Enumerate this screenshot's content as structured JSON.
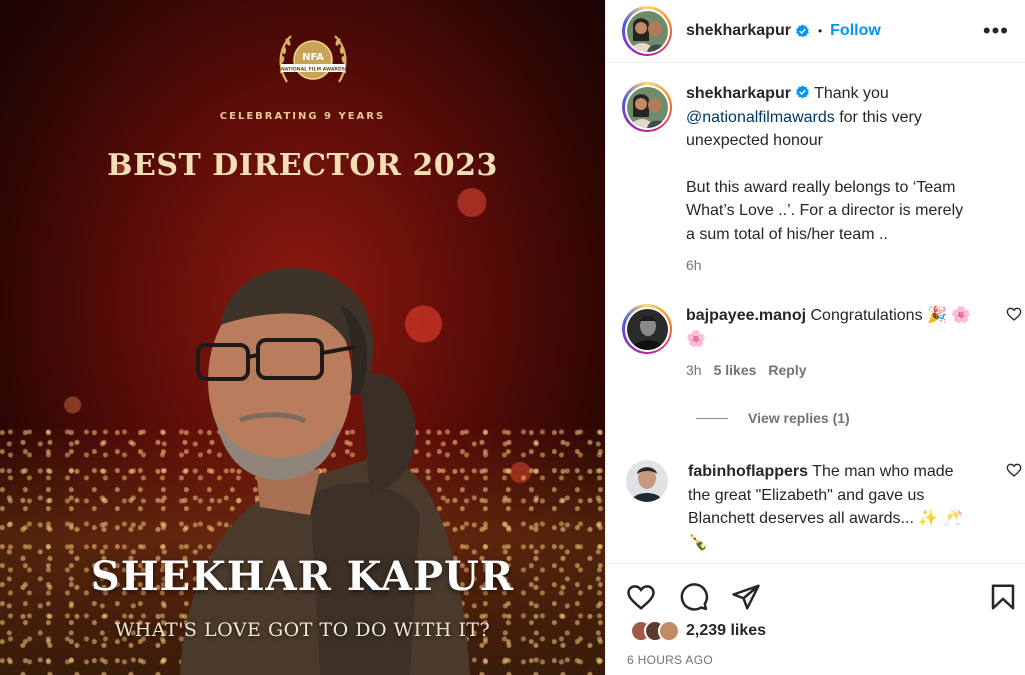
{
  "post_image": {
    "award_logo_text": "NFA",
    "award_logo_subtext": "NATIONAL FILM AWARDS",
    "celebrating": "CELEBRATING 9 YEARS",
    "award_title": "BEST DIRECTOR 2023",
    "winner_name": "SHEKHAR KAPUR",
    "film_name": "WHAT'S LOVE GOT TO DO WITH IT?"
  },
  "header": {
    "username": "shekharkapur",
    "separator": "•",
    "follow_label": "Follow",
    "more_icon": "more-horizontal-icon",
    "more_label": "•••"
  },
  "caption": {
    "username": "shekharkapur",
    "text_start": " Thank you ",
    "mention": "@nationalfilmawards",
    "text_end": " for this very unexpected honour",
    "paragraph_2": "But this award really belongs to ‘Team What’s Love ..’. For a director is merely a sum total of his/her team ..",
    "time": "6h"
  },
  "comments": [
    {
      "username": "bajpayee.manoj",
      "text": " Congratulations 🎉 🌸🌸",
      "time": "3h",
      "likes": "5 likes",
      "reply": "Reply",
      "view_replies": "View replies (1)"
    },
    {
      "username": "fabinhoflappers",
      "text": " The man who made the great \"Elizabeth\" and gave us Blanchett deserves all awards... ✨ 🥂🍾"
    }
  ],
  "actions": {
    "like_icon": "heart-icon",
    "comment_icon": "comment-icon",
    "share_icon": "paper-plane-icon",
    "save_icon": "bookmark-icon"
  },
  "likes_text": "2,239 likes",
  "post_time": "6 HOURS AGO",
  "colors": {
    "follow": "#0095f6",
    "mention": "#00376b",
    "secondary_text": "#737373",
    "poster_gold": "#f3dfb6"
  }
}
